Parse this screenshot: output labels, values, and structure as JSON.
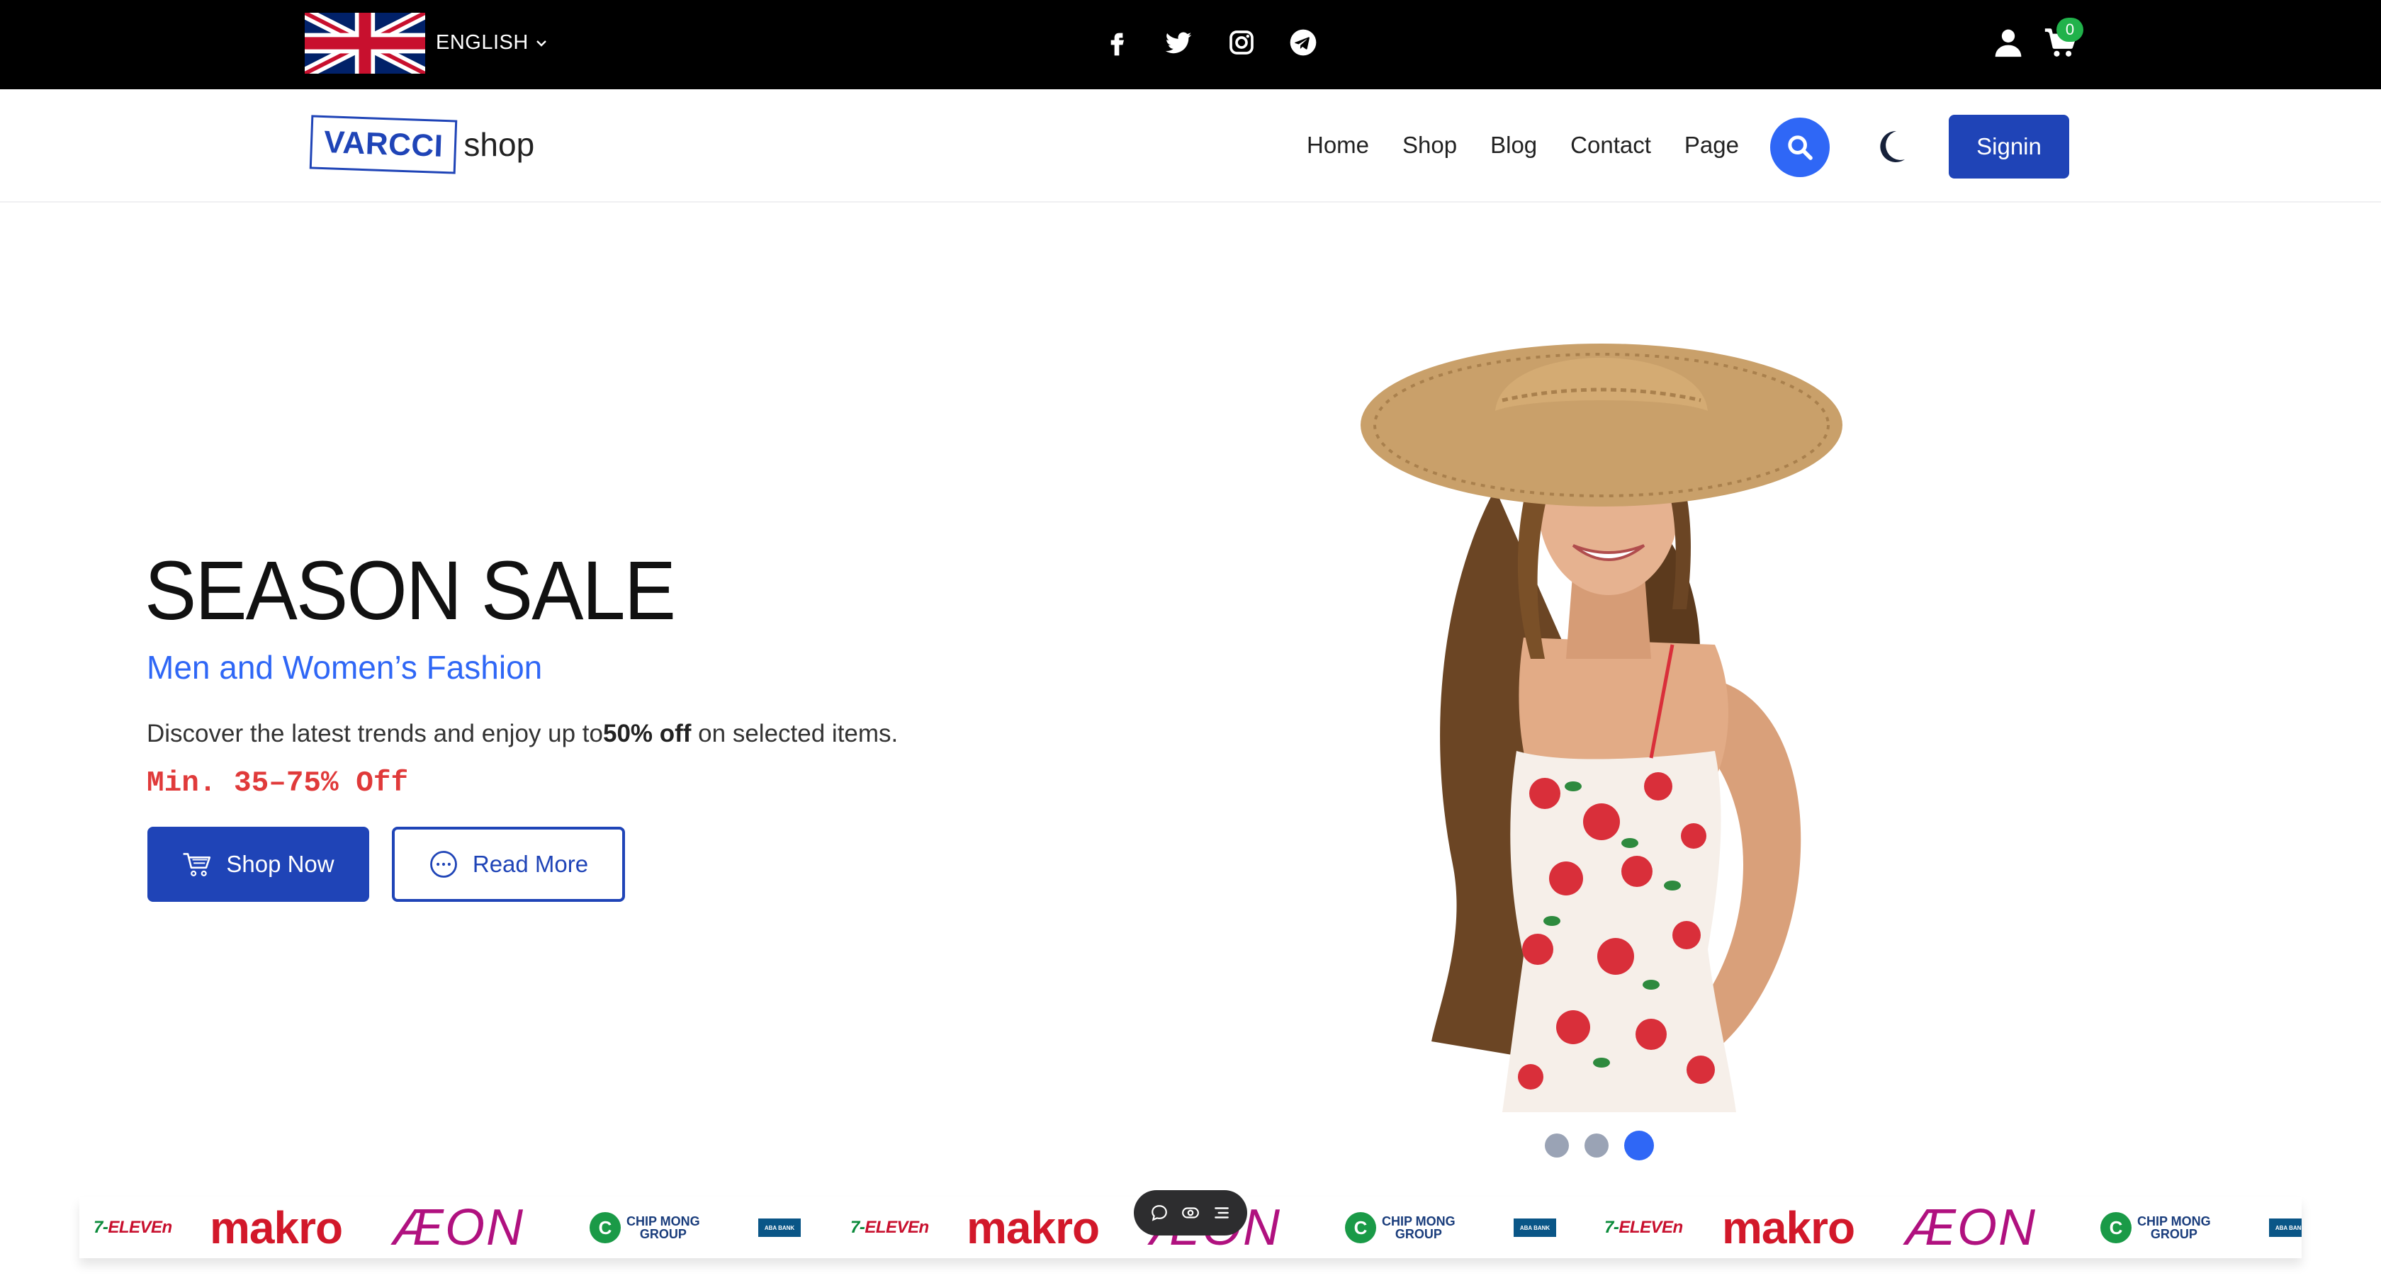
{
  "topbar": {
    "language_label": "ENGLISH",
    "social_icons": [
      "facebook-icon",
      "twitter-icon",
      "instagram-icon",
      "telegram-icon"
    ],
    "cart_count": "0"
  },
  "nav": {
    "logo_boxed": "VARCCI",
    "logo_text": "shop",
    "links": [
      "Home",
      "Shop",
      "Blog",
      "Contact",
      "Page"
    ],
    "signin_label": "Signin"
  },
  "hero": {
    "title": "SEASON SALE",
    "subtitle": "Men and Women’s Fashion",
    "description_before": "Discover the latest trends and enjoy up to",
    "description_bold": "50% off",
    "description_after": " on selected items.",
    "discount": "Min. 35–75% Off",
    "shop_now_label": "Shop Now",
    "read_more_label": "Read More",
    "slide_count": 3,
    "active_slide": 3
  },
  "brands": {
    "seven_eleven_num": "7-",
    "seven_eleven": "ELEVEn",
    "makro": "makro",
    "aeon": "ÆON",
    "chip_mong_line1": "CHIP MONG",
    "chip_mong_line2": "GROUP",
    "aba": "ABA BANK"
  },
  "colors": {
    "accent_blue": "#1f44b7",
    "bright_blue": "#2f67f6",
    "discount_red": "#e03a3a",
    "cart_badge_green": "#21b24b"
  }
}
